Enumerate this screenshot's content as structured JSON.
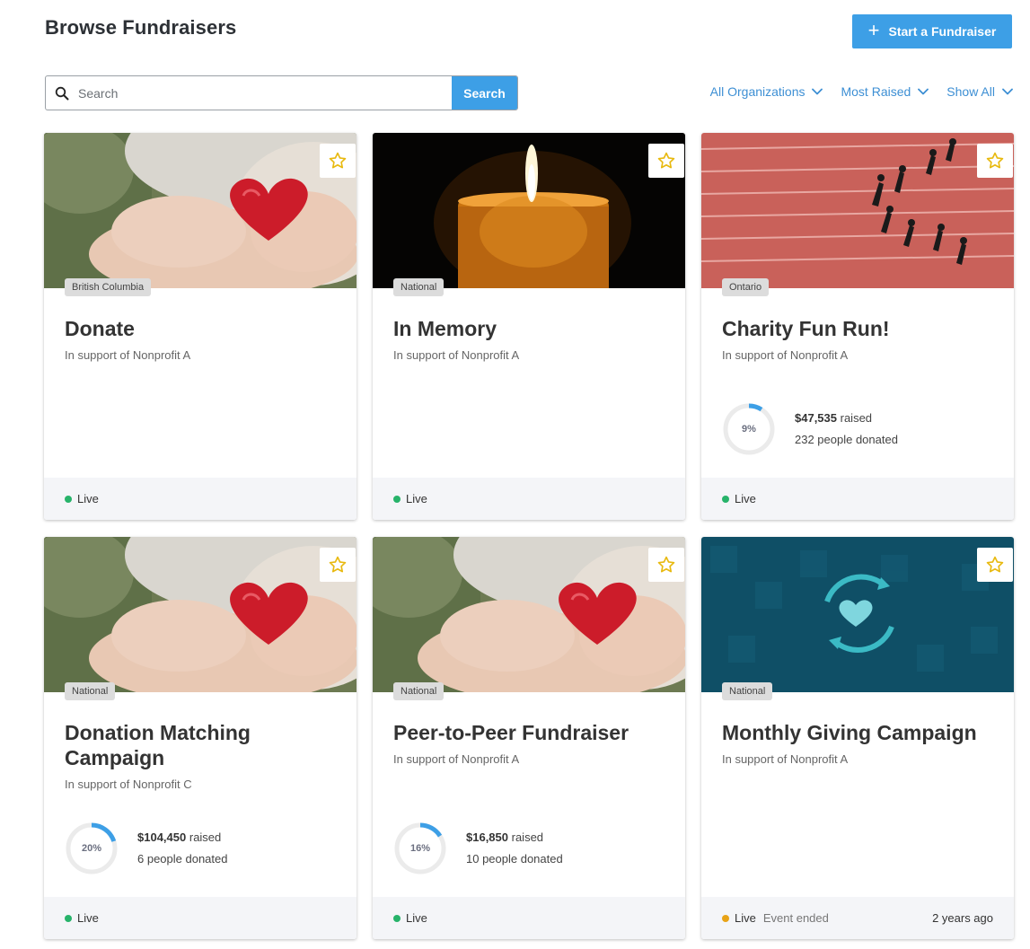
{
  "header": {
    "title": "Browse Fundraisers",
    "start_label": "Start a Fundraiser"
  },
  "search": {
    "placeholder": "Search",
    "value": "",
    "button_label": "Search"
  },
  "filters": [
    {
      "label": "All Organizations"
    },
    {
      "label": "Most Raised"
    },
    {
      "label": "Show All"
    }
  ],
  "colors": {
    "accent": "#3d9fe6",
    "link": "#3d8fd4",
    "live": "#27b36a",
    "ended": "#e8a317",
    "star": "#e8b90f"
  },
  "cards": [
    {
      "image": "heart-hands-photo",
      "region": "British Columbia",
      "title": "Donate",
      "support": "In support of Nonprofit A",
      "status": "Live"
    },
    {
      "image": "candle-photo",
      "region": "National",
      "title": "In Memory",
      "support": "In support of Nonprofit A",
      "status": "Live"
    },
    {
      "image": "runners-track-photo",
      "region": "Ontario",
      "title": "Charity Fun Run!",
      "support": "In support of Nonprofit A",
      "progress": 9,
      "progress_label": "9%",
      "raised": "$47,535",
      "raised_suffix": "raised",
      "donors": "232 people donated",
      "status": "Live"
    },
    {
      "image": "heart-hands-photo",
      "region": "National",
      "title": "Donation Matching Campaign",
      "support": "In support of Nonprofit C",
      "progress": 20,
      "progress_label": "20%",
      "raised": "$104,450",
      "raised_suffix": "raised",
      "donors": "6 people donated",
      "status": "Live"
    },
    {
      "image": "heart-hands-photo",
      "region": "National",
      "title": "Peer-to-Peer Fundraiser",
      "support": "In support of Nonprofit A",
      "progress": 16,
      "progress_label": "16%",
      "raised": "$16,850",
      "raised_suffix": "raised",
      "donors": "10 people donated",
      "status": "Live"
    },
    {
      "image": "recurring-heart-banner",
      "region": "National",
      "title": "Monthly Giving Campaign",
      "support": "In support of Nonprofit A",
      "status": "Live",
      "ended_label": "Event ended",
      "time_ago": "2 years ago"
    }
  ]
}
